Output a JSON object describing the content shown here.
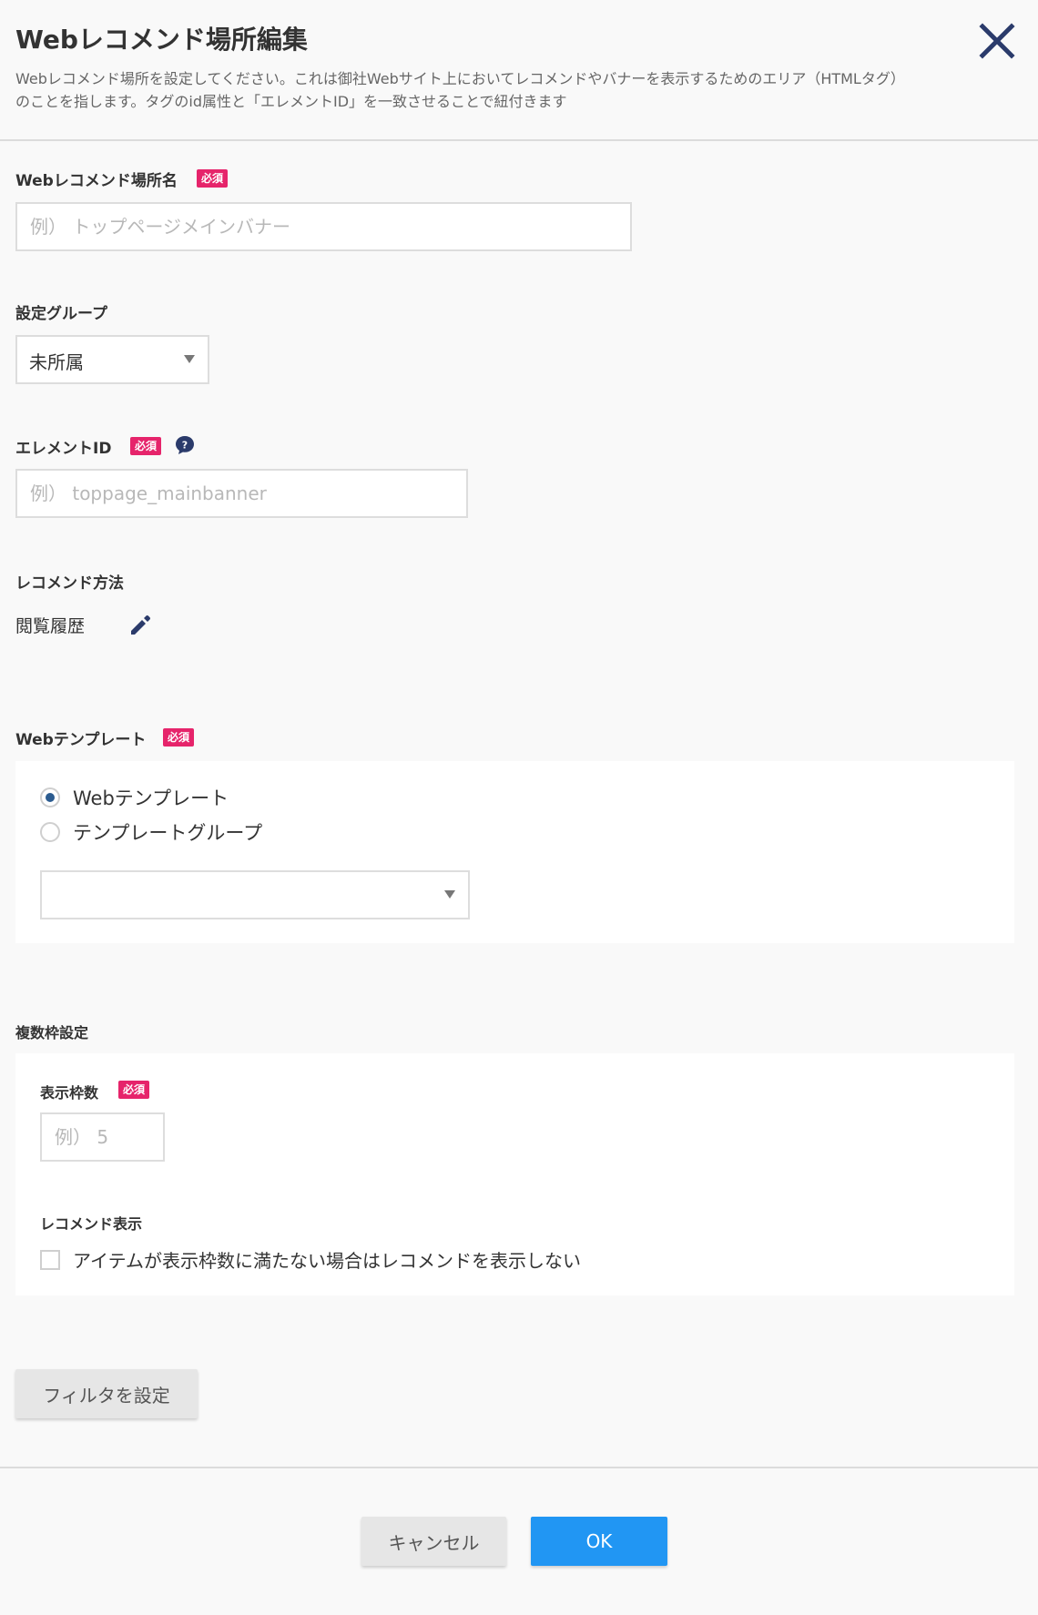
{
  "header": {
    "title": "Webレコメンド場所編集",
    "description": "Webレコメンド場所を設定してください。これは御社Webサイト上においてレコメンドやバナーを表示するためのエリア（HTMLタグ）のことを指します。タグのid属性と「エレメントID」を一致させることで紐付きます",
    "close_icon": "close-icon"
  },
  "required_badge": "必須",
  "fields": {
    "location_name": {
      "label": "Webレコメンド場所名",
      "value": "",
      "placeholder": "例） トップページメインバナー"
    },
    "setting_group": {
      "label": "設定グループ",
      "selected": "未所属"
    },
    "element_id": {
      "label": "エレメントID",
      "value": "",
      "placeholder": "例） toppage_mainbanner",
      "help_icon": "question-icon"
    },
    "recommend_method": {
      "label": "レコメンド方法",
      "value": "閲覧履歴",
      "edit_icon": "pencil-icon"
    },
    "web_template": {
      "label": "Webテンプレート",
      "options": [
        "Webテンプレート",
        "テンプレートグループ"
      ],
      "selected_option": "Webテンプレート",
      "select_value": ""
    },
    "multi_frame": {
      "label": "複数枠設定",
      "display_count": {
        "label": "表示枠数",
        "value": "",
        "placeholder": "例） 5"
      },
      "recommend_display": {
        "label": "レコメンド表示",
        "checkbox_label": "アイテムが表示枠数に満たない場合はレコメンドを表示しない",
        "checked": false
      }
    }
  },
  "buttons": {
    "filter": "フィルタを設定",
    "cancel": "キャンセル",
    "ok": "OK"
  },
  "colors": {
    "accent_blue": "#2196f3",
    "required_badge": "#e6246b",
    "icon_navy": "#2b3b6b",
    "background": "#f9f9f9"
  }
}
